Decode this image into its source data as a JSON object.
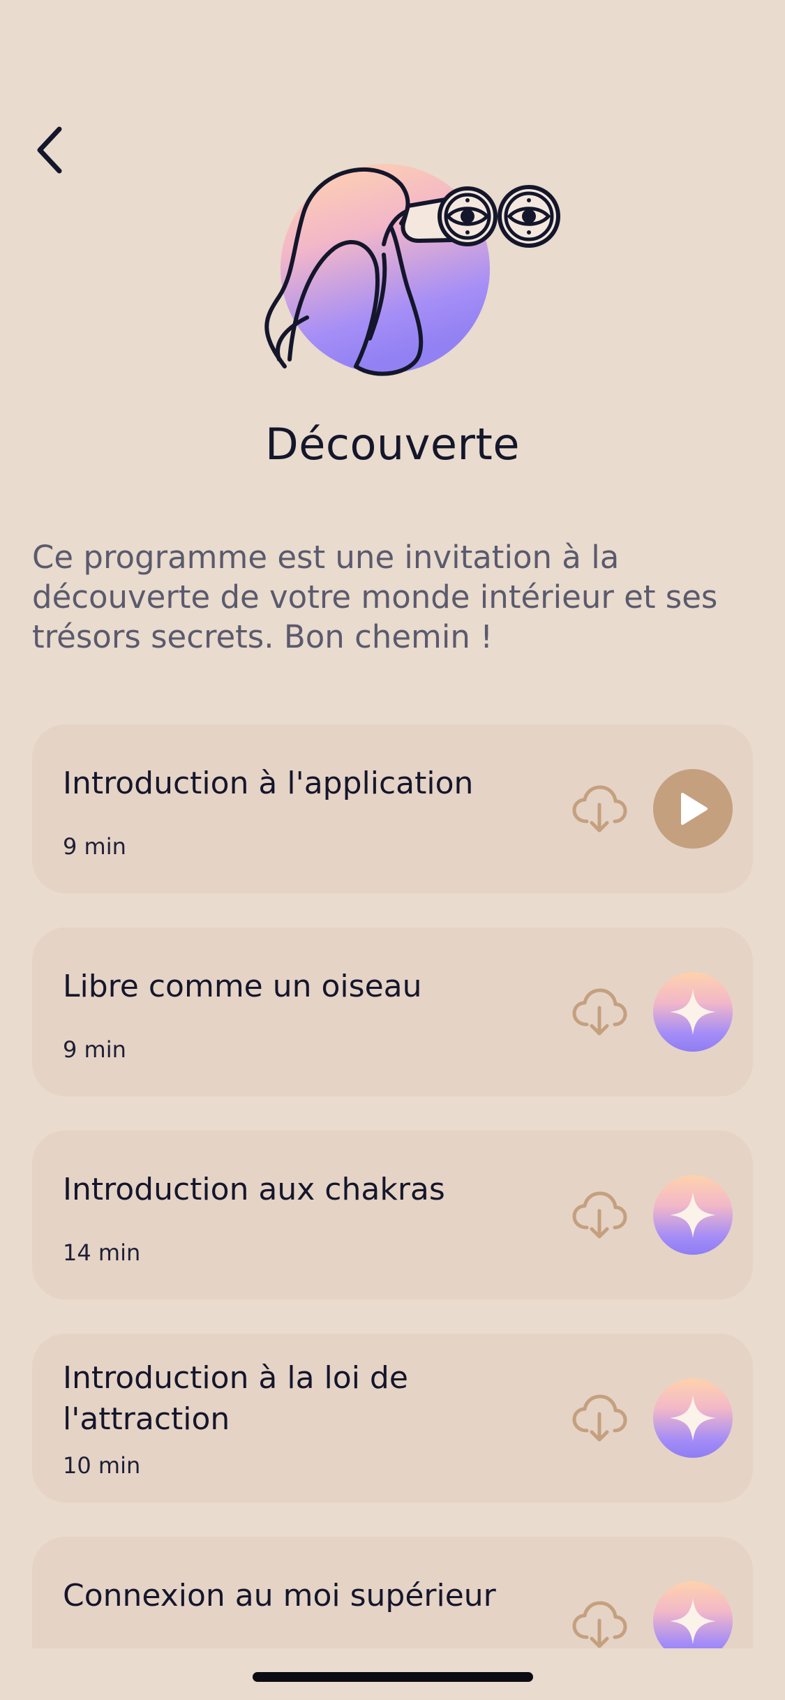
{
  "header": {
    "back_icon": "chevron-left-icon",
    "hero_illustration": "binoculars-illustration"
  },
  "program": {
    "title": "Découverte",
    "description": "Ce programme est une invitation à la découverte de votre monde intérieur et ses trésors secrets. Bon chemin !"
  },
  "sessions": [
    {
      "title": "Introduction à l'application",
      "duration": "9 min",
      "action_icon": "play-icon",
      "download_icon": "cloud-download-icon"
    },
    {
      "title": "Libre comme un oiseau",
      "duration": "9 min",
      "action_icon": "sparkle-icon",
      "download_icon": "cloud-download-icon"
    },
    {
      "title": "Introduction aux chakras",
      "duration": "14 min",
      "action_icon": "sparkle-icon",
      "download_icon": "cloud-download-icon"
    },
    {
      "title": "Introduction à la loi de l'attraction",
      "duration": "10 min",
      "action_icon": "sparkle-icon",
      "download_icon": "cloud-download-icon"
    },
    {
      "title": "Connexion au moi supérieur",
      "action_icon": "sparkle-icon",
      "download_icon": "cloud-download-icon"
    }
  ],
  "colors": {
    "background": "#e9dbcd",
    "card": "#e5d3c6",
    "accent": "#c4a07f",
    "text": "#14162b",
    "gradient_top": "#ffd2ac",
    "gradient_bottom": "#8f7df3"
  }
}
